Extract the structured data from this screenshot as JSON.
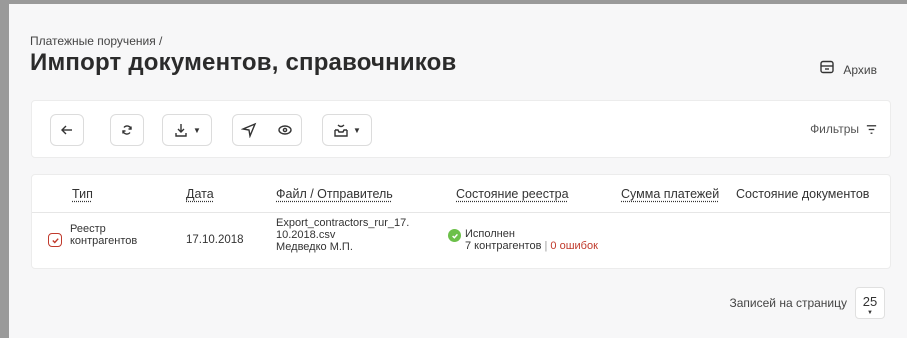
{
  "breadcrumb": "Платежные поручения /",
  "title": "Импорт документов, справочников",
  "archive": {
    "label": "Архив",
    "icon": "archive-icon"
  },
  "toolbar": {
    "buttons": [
      {
        "name": "back-button",
        "icon": "arrow-left-icon"
      },
      {
        "name": "refresh-button",
        "icon": "refresh-icon"
      },
      {
        "name": "download-button",
        "icon": "download-icon"
      },
      {
        "name": "send-button",
        "icon": "send-icon"
      },
      {
        "name": "view-button",
        "icon": "eye-icon"
      },
      {
        "name": "import-button",
        "icon": "inbox-icon"
      }
    ],
    "filters_label": "Фильтры"
  },
  "table": {
    "columns": [
      "Тип",
      "Дата",
      "Файл / Отправитель",
      "Состояние реестра",
      "Сумма платежей",
      "Состояние документов"
    ],
    "rows": [
      {
        "type_line1": "Реестр",
        "type_line2": "контрагентов",
        "date": "17.10.2018",
        "file_line1": "Export_contractors_rur_17.",
        "file_line2": "10.2018.csv",
        "sender": "Медведко М.П.",
        "status": "Исполнен",
        "status_detail": "7 контрагентов",
        "separator": "|",
        "errors": "0 ошибок"
      }
    ]
  },
  "pager": {
    "label": "Записей на страницу",
    "value": "25"
  },
  "colors": {
    "accent": "#c0392b",
    "success": "#6cc04a",
    "background": "#f7f7f8"
  }
}
